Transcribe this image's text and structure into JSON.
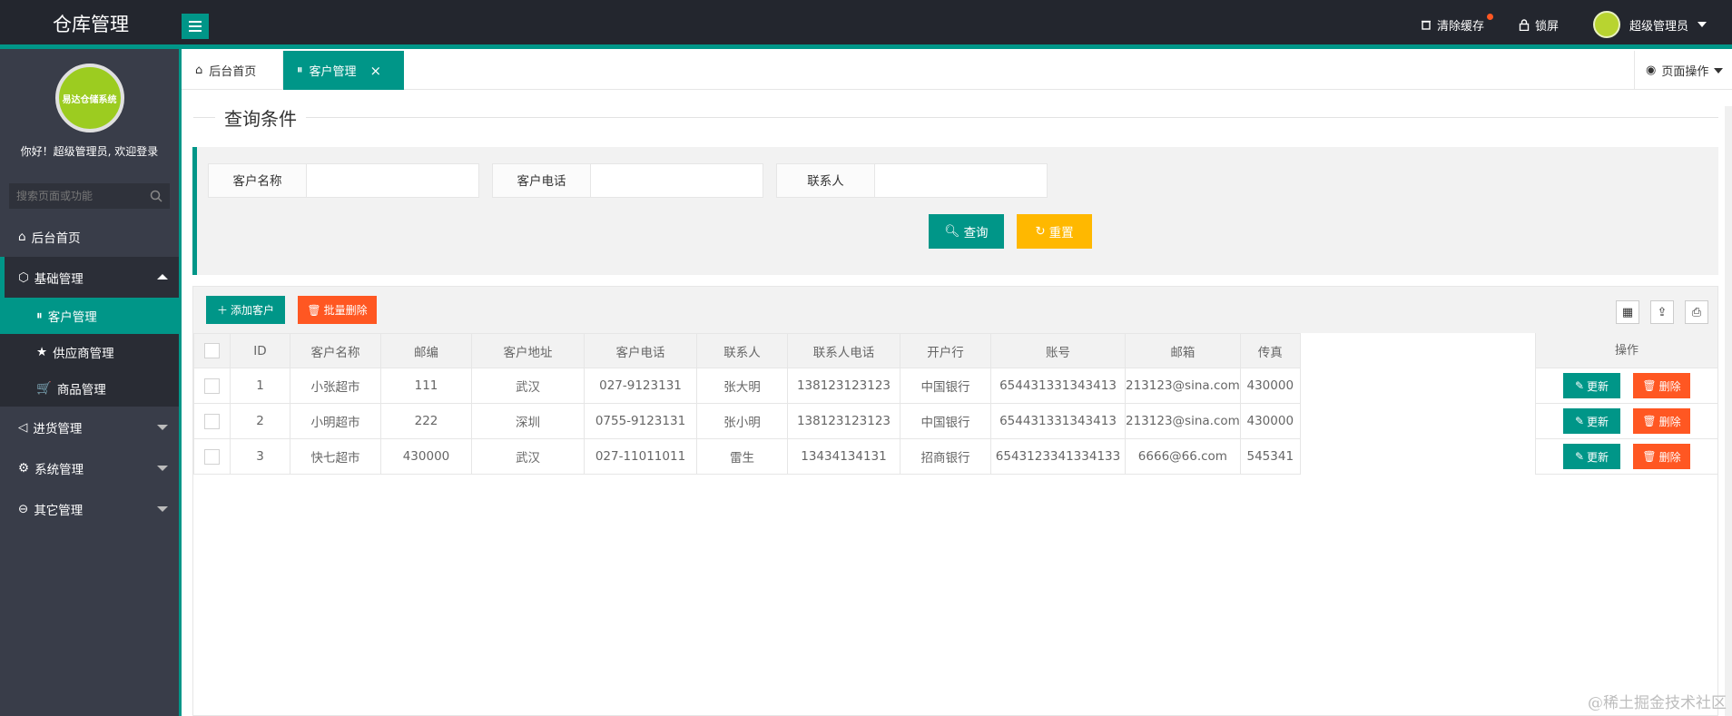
{
  "app": {
    "title": "仓库管理",
    "accent": "#009688"
  },
  "topbar": {
    "clear_cache": "清除缓存",
    "lock_screen": "锁屏",
    "user": "超级管理员"
  },
  "sidebar": {
    "logo_text": "易达仓储系统",
    "welcome": "你好！超级管理员, 欢迎登录",
    "search_placeholder": "搜索页面或功能",
    "items": [
      {
        "label": "后台首页",
        "icon": "home-icon"
      },
      {
        "label": "基础管理",
        "icon": "cube-icon",
        "open": true
      },
      {
        "label": "进货管理",
        "icon": "speaker-icon"
      },
      {
        "label": "系统管理",
        "icon": "gear-icon"
      },
      {
        "label": "其它管理",
        "icon": "exit-icon"
      }
    ],
    "sub_items": [
      {
        "label": "客户管理",
        "icon": "pause-circle-icon",
        "active": true
      },
      {
        "label": "供应商管理",
        "icon": "star-icon"
      },
      {
        "label": "商品管理",
        "icon": "cart-icon"
      }
    ]
  },
  "tabs": {
    "home": "后台首页",
    "current": "客户管理",
    "close": "×",
    "page_ops": "页面操作"
  },
  "query": {
    "section_title": "查询条件",
    "fields": [
      {
        "label": "客户名称",
        "value": ""
      },
      {
        "label": "客户电话",
        "value": ""
      },
      {
        "label": "联系人",
        "value": ""
      }
    ],
    "search_button": "查询",
    "reset_button": "重置"
  },
  "table": {
    "add_button": "添加客户",
    "batch_delete_button": "批量删除",
    "columns": [
      "ID",
      "客户名称",
      "邮编",
      "客户地址",
      "客户电话",
      "联系人",
      "联系人电话",
      "开户行",
      "账号",
      "邮箱",
      "传真"
    ],
    "ops_header": "操作",
    "update_label": "更新",
    "delete_label": "删除",
    "rows": [
      [
        "1",
        "小张超市",
        "111",
        "武汉",
        "027-9123131",
        "张大明",
        "138123123123",
        "中国银行",
        "654431331343413",
        "213123@sina.com",
        "430000"
      ],
      [
        "2",
        "小明超市",
        "222",
        "深圳",
        "0755-9123131",
        "张小明",
        "138123123123",
        "中国银行",
        "654431331343413",
        "213123@sina.com",
        "430000"
      ],
      [
        "3",
        "快七超市",
        "430000",
        "武汉",
        "027-11011011",
        "雷生",
        "13434134131",
        "招商银行",
        "6543123341334133",
        "6666@66.com",
        "545341"
      ]
    ]
  },
  "watermark": "@稀土掘金技术社区"
}
